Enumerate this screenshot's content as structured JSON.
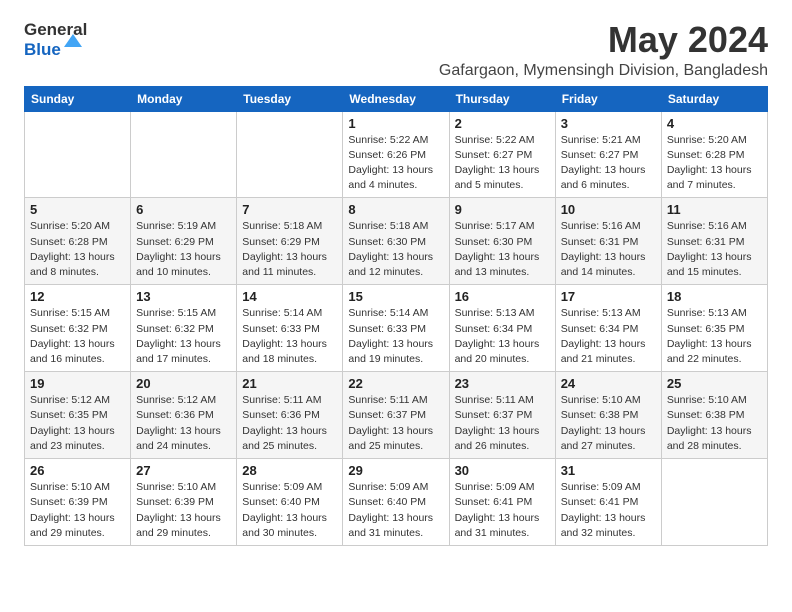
{
  "logo": {
    "line1": "General",
    "line2": "Blue"
  },
  "title": "May 2024",
  "subtitle": "Gafargaon, Mymensingh Division, Bangladesh",
  "weekdays": [
    "Sunday",
    "Monday",
    "Tuesday",
    "Wednesday",
    "Thursday",
    "Friday",
    "Saturday"
  ],
  "weeks": [
    [
      {
        "day": "",
        "info": ""
      },
      {
        "day": "",
        "info": ""
      },
      {
        "day": "",
        "info": ""
      },
      {
        "day": "1",
        "info": "Sunrise: 5:22 AM\nSunset: 6:26 PM\nDaylight: 13 hours\nand 4 minutes."
      },
      {
        "day": "2",
        "info": "Sunrise: 5:22 AM\nSunset: 6:27 PM\nDaylight: 13 hours\nand 5 minutes."
      },
      {
        "day": "3",
        "info": "Sunrise: 5:21 AM\nSunset: 6:27 PM\nDaylight: 13 hours\nand 6 minutes."
      },
      {
        "day": "4",
        "info": "Sunrise: 5:20 AM\nSunset: 6:28 PM\nDaylight: 13 hours\nand 7 minutes."
      }
    ],
    [
      {
        "day": "5",
        "info": "Sunrise: 5:20 AM\nSunset: 6:28 PM\nDaylight: 13 hours\nand 8 minutes."
      },
      {
        "day": "6",
        "info": "Sunrise: 5:19 AM\nSunset: 6:29 PM\nDaylight: 13 hours\nand 10 minutes."
      },
      {
        "day": "7",
        "info": "Sunrise: 5:18 AM\nSunset: 6:29 PM\nDaylight: 13 hours\nand 11 minutes."
      },
      {
        "day": "8",
        "info": "Sunrise: 5:18 AM\nSunset: 6:30 PM\nDaylight: 13 hours\nand 12 minutes."
      },
      {
        "day": "9",
        "info": "Sunrise: 5:17 AM\nSunset: 6:30 PM\nDaylight: 13 hours\nand 13 minutes."
      },
      {
        "day": "10",
        "info": "Sunrise: 5:16 AM\nSunset: 6:31 PM\nDaylight: 13 hours\nand 14 minutes."
      },
      {
        "day": "11",
        "info": "Sunrise: 5:16 AM\nSunset: 6:31 PM\nDaylight: 13 hours\nand 15 minutes."
      }
    ],
    [
      {
        "day": "12",
        "info": "Sunrise: 5:15 AM\nSunset: 6:32 PM\nDaylight: 13 hours\nand 16 minutes."
      },
      {
        "day": "13",
        "info": "Sunrise: 5:15 AM\nSunset: 6:32 PM\nDaylight: 13 hours\nand 17 minutes."
      },
      {
        "day": "14",
        "info": "Sunrise: 5:14 AM\nSunset: 6:33 PM\nDaylight: 13 hours\nand 18 minutes."
      },
      {
        "day": "15",
        "info": "Sunrise: 5:14 AM\nSunset: 6:33 PM\nDaylight: 13 hours\nand 19 minutes."
      },
      {
        "day": "16",
        "info": "Sunrise: 5:13 AM\nSunset: 6:34 PM\nDaylight: 13 hours\nand 20 minutes."
      },
      {
        "day": "17",
        "info": "Sunrise: 5:13 AM\nSunset: 6:34 PM\nDaylight: 13 hours\nand 21 minutes."
      },
      {
        "day": "18",
        "info": "Sunrise: 5:13 AM\nSunset: 6:35 PM\nDaylight: 13 hours\nand 22 minutes."
      }
    ],
    [
      {
        "day": "19",
        "info": "Sunrise: 5:12 AM\nSunset: 6:35 PM\nDaylight: 13 hours\nand 23 minutes."
      },
      {
        "day": "20",
        "info": "Sunrise: 5:12 AM\nSunset: 6:36 PM\nDaylight: 13 hours\nand 24 minutes."
      },
      {
        "day": "21",
        "info": "Sunrise: 5:11 AM\nSunset: 6:36 PM\nDaylight: 13 hours\nand 25 minutes."
      },
      {
        "day": "22",
        "info": "Sunrise: 5:11 AM\nSunset: 6:37 PM\nDaylight: 13 hours\nand 25 minutes."
      },
      {
        "day": "23",
        "info": "Sunrise: 5:11 AM\nSunset: 6:37 PM\nDaylight: 13 hours\nand 26 minutes."
      },
      {
        "day": "24",
        "info": "Sunrise: 5:10 AM\nSunset: 6:38 PM\nDaylight: 13 hours\nand 27 minutes."
      },
      {
        "day": "25",
        "info": "Sunrise: 5:10 AM\nSunset: 6:38 PM\nDaylight: 13 hours\nand 28 minutes."
      }
    ],
    [
      {
        "day": "26",
        "info": "Sunrise: 5:10 AM\nSunset: 6:39 PM\nDaylight: 13 hours\nand 29 minutes."
      },
      {
        "day": "27",
        "info": "Sunrise: 5:10 AM\nSunset: 6:39 PM\nDaylight: 13 hours\nand 29 minutes."
      },
      {
        "day": "28",
        "info": "Sunrise: 5:09 AM\nSunset: 6:40 PM\nDaylight: 13 hours\nand 30 minutes."
      },
      {
        "day": "29",
        "info": "Sunrise: 5:09 AM\nSunset: 6:40 PM\nDaylight: 13 hours\nand 31 minutes."
      },
      {
        "day": "30",
        "info": "Sunrise: 5:09 AM\nSunset: 6:41 PM\nDaylight: 13 hours\nand 31 minutes."
      },
      {
        "day": "31",
        "info": "Sunrise: 5:09 AM\nSunset: 6:41 PM\nDaylight: 13 hours\nand 32 minutes."
      },
      {
        "day": "",
        "info": ""
      }
    ]
  ]
}
